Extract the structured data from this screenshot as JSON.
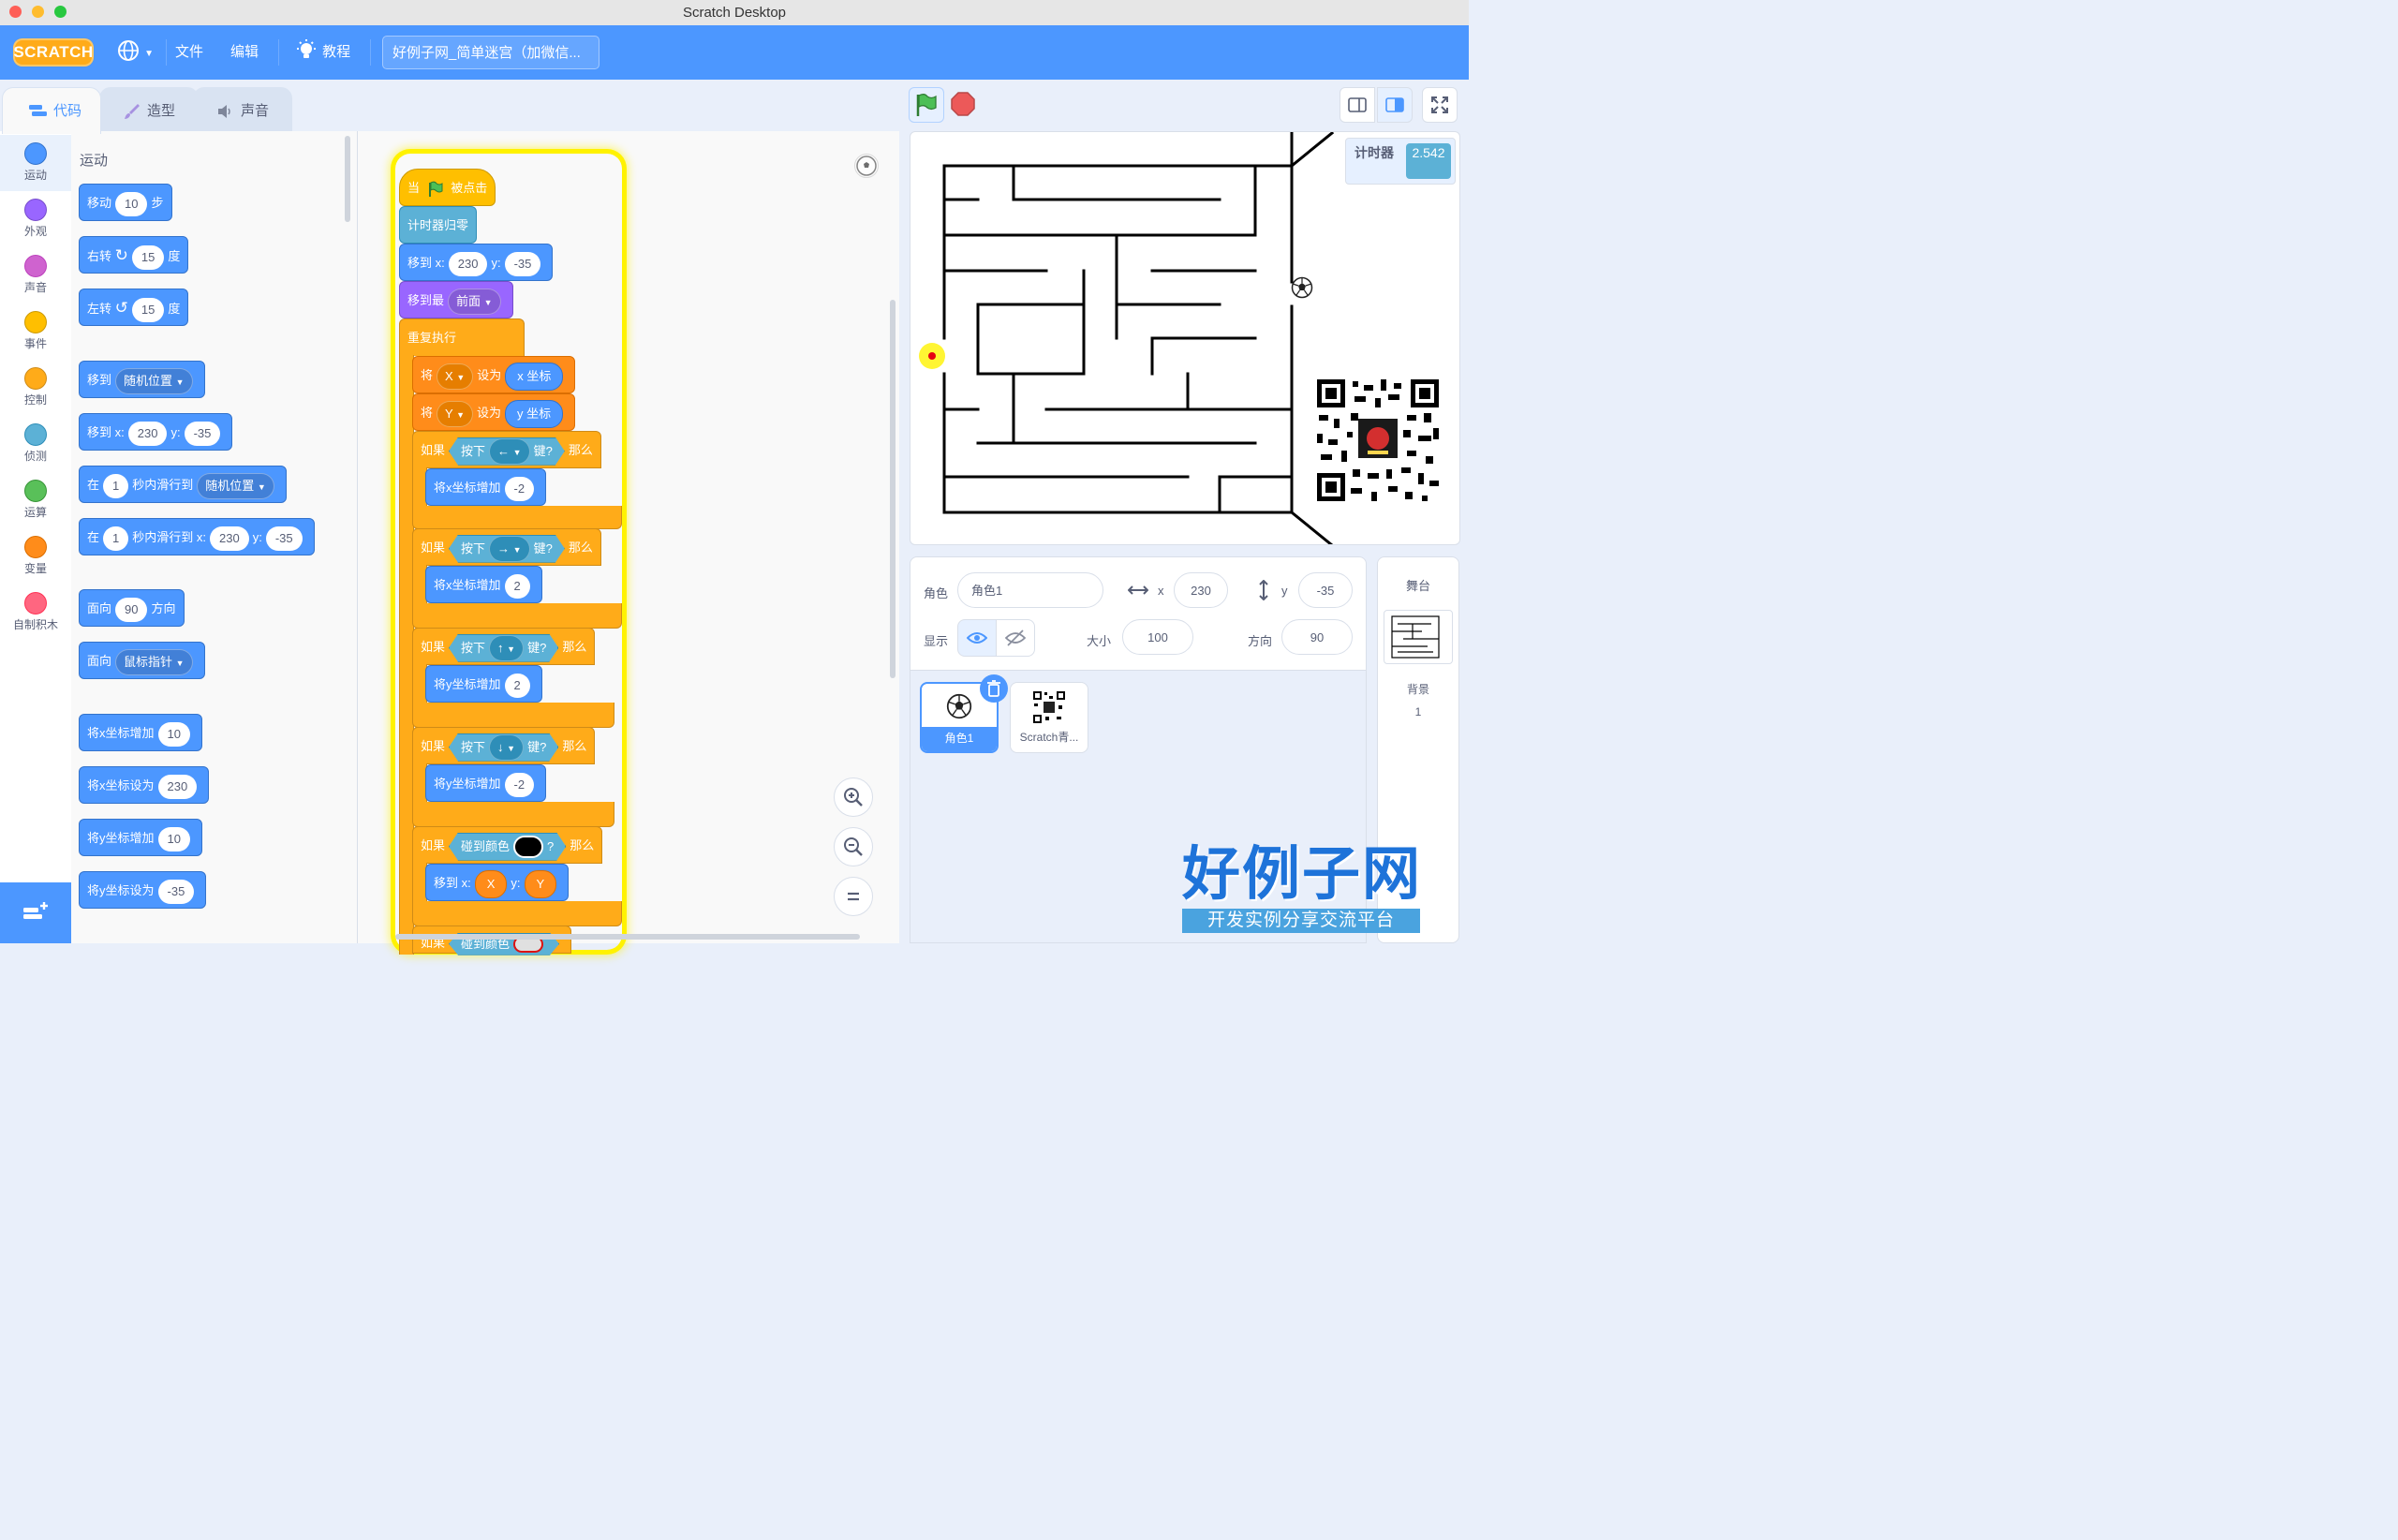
{
  "window": {
    "title": "Scratch Desktop"
  },
  "menubar": {
    "logo": "SCRATCH",
    "file": "文件",
    "edit": "编辑",
    "tutorials": "教程",
    "project_title": "好例子网_简单迷宫（加微信..."
  },
  "tabs": {
    "code": "代码",
    "costumes": "造型",
    "sounds": "声音"
  },
  "categories": [
    {
      "label": "运动",
      "color": "#4c97ff"
    },
    {
      "label": "外观",
      "color": "#9966ff"
    },
    {
      "label": "声音",
      "color": "#cf63cf"
    },
    {
      "label": "事件",
      "color": "#ffbf00"
    },
    {
      "label": "控制",
      "color": "#ffab19"
    },
    {
      "label": "侦测",
      "color": "#5cb1d6"
    },
    {
      "label": "运算",
      "color": "#59c059"
    },
    {
      "label": "变量",
      "color": "#ff8c1a"
    },
    {
      "label": "自制积木",
      "color": "#ff6680"
    }
  ],
  "flyout": {
    "heading": "运动",
    "move": {
      "a": "移动",
      "v": "10",
      "b": "步"
    },
    "turn_right": {
      "a": "右转",
      "v": "15",
      "b": "度"
    },
    "turn_left": {
      "a": "左转",
      "v": "15",
      "b": "度"
    },
    "goto": {
      "a": "移到",
      "menu": "随机位置"
    },
    "goto_xy": {
      "a": "移到 x:",
      "x": "230",
      "ylbl": "y:",
      "y": "-35"
    },
    "glide": {
      "a": "在",
      "v": "1",
      "b": "秒内滑行到",
      "menu": "随机位置"
    },
    "glide_xy": {
      "a": "在",
      "v": "1",
      "b": "秒内滑行到 x:",
      "x": "230",
      "ylbl": "y:",
      "y": "-35"
    },
    "point_dir": {
      "a": "面向",
      "v": "90",
      "b": "方向"
    },
    "point_towards": {
      "a": "面向",
      "menu": "鼠标指针"
    },
    "change_x": {
      "a": "将x坐标增加",
      "v": "10"
    },
    "set_x": {
      "a": "将x坐标设为",
      "v": "230"
    },
    "change_y": {
      "a": "将y坐标增加",
      "v": "10"
    },
    "set_y": {
      "a": "将y坐标设为",
      "v": "-35"
    }
  },
  "script": {
    "hat": {
      "a": "当",
      "b": "被点击"
    },
    "reset_timer": "计时器归零",
    "goto_xy": {
      "a": "移到 x:",
      "x": "230",
      "ylbl": "y:",
      "y": "-35"
    },
    "goto_front": {
      "a": "移到最",
      "menu": "前面"
    },
    "forever": "重复执行",
    "set_x_var": {
      "a": "将",
      "var": "X",
      "b": "设为",
      "rep": "x 坐标"
    },
    "set_y_var": {
      "a": "将",
      "var": "Y",
      "b": "设为",
      "rep": "y 坐标"
    },
    "if_left": {
      "a": "如果",
      "press": "按下",
      "key": "←",
      "q": "键?",
      "then": "那么",
      "body": "将x坐标增加",
      "v": "-2"
    },
    "if_right": {
      "a": "如果",
      "press": "按下",
      "key": "→",
      "q": "键?",
      "then": "那么",
      "body": "将x坐标增加",
      "v": "2"
    },
    "if_up": {
      "a": "如果",
      "press": "按下",
      "key": "↑",
      "q": "键?",
      "then": "那么",
      "body": "将y坐标增加",
      "v": "2"
    },
    "if_down": {
      "a": "如果",
      "press": "按下",
      "key": "↓",
      "q": "键?",
      "then": "那么",
      "body": "将y坐标增加",
      "v": "-2"
    },
    "if_color": {
      "a": "如果",
      "touch": "碰到颜色",
      "q": "?",
      "then": "那么",
      "body": "移到 x:",
      "x": "X",
      "ylbl": "y:",
      "y": "Y"
    },
    "if_color2": {
      "a": "如果",
      "touch": "碰到颜色"
    }
  },
  "stage": {
    "timer_label": "计时器",
    "timer_value": "2.542"
  },
  "sprite_info": {
    "sprite_label": "角色",
    "sprite_name": "角色1",
    "x_label": "x",
    "x_value": "230",
    "y_label": "y",
    "y_value": "-35",
    "show_label": "显示",
    "size_label": "大小",
    "size_value": "100",
    "direction_label": "方向",
    "direction_value": "90"
  },
  "sprites": [
    {
      "name": "角色1"
    },
    {
      "name": "Scratch青..."
    }
  ],
  "stage_panel": {
    "title": "舞台",
    "backdrops_label": "背景",
    "backdrops_count": "1"
  },
  "watermark": {
    "big": "好例子网",
    "small": "开发实例分享交流平台"
  }
}
